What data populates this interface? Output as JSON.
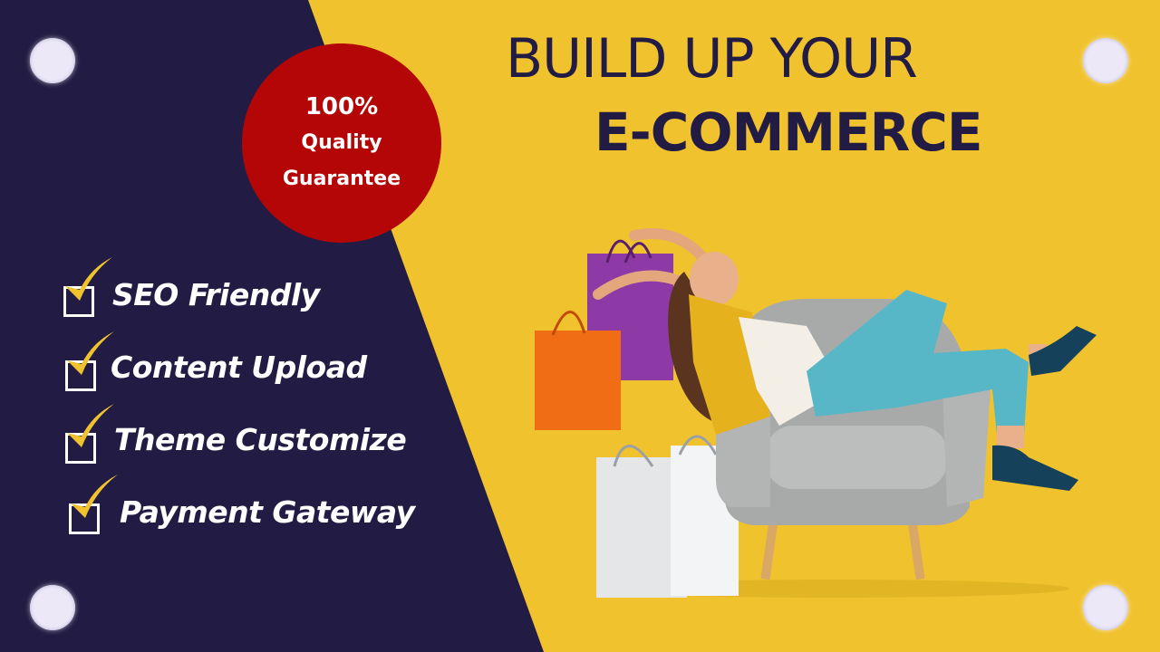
{
  "badge": {
    "percent": "100%",
    "line1": "Quality",
    "line2": "Guarantee"
  },
  "headline": {
    "line1": "BUILD UP YOUR",
    "line2": "E-COMMERCE"
  },
  "features": [
    {
      "label": "SEO Friendly"
    },
    {
      "label": "Content Upload"
    },
    {
      "label": "Theme Customize"
    },
    {
      "label": "Payment Gateway"
    }
  ],
  "colors": {
    "navy": "#221c44",
    "yellow": "#f0c22e",
    "badge_red": "#b40606",
    "check_gold": "#f0c22e"
  },
  "illustration": {
    "subject": "woman relaxing in grey armchair with shopping bags",
    "icons": [
      "checkmark-icon"
    ]
  }
}
